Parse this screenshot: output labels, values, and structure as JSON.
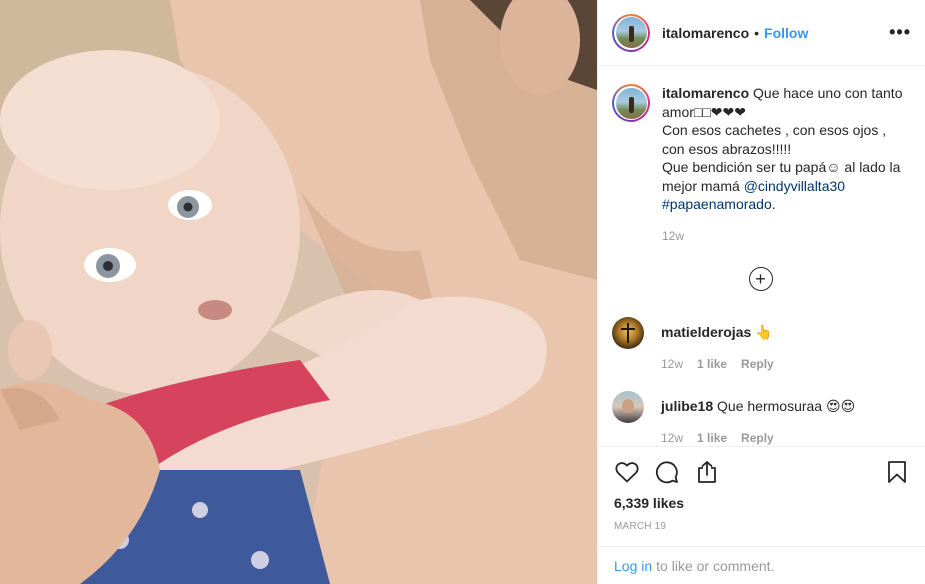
{
  "post": {
    "username": "italomarenco",
    "follow_label": "Follow",
    "separator": "•",
    "more_label": "•••",
    "caption": {
      "username": "italomarenco",
      "line1": "Que hace uno con tanto amor□□❤❤❤",
      "line2": "Con esos cachetes , con esos ojos , con esos abrazos!!!!!",
      "line3": "Que bendición ser tu papá☺ al lado la mejor mamá ",
      "mention": "@cindyvillalta30",
      "hashtag": "#papaenamorado",
      "hashtag_suffix": ".",
      "time": "12w"
    },
    "load_more_label": "+",
    "comments": [
      {
        "username": "matielderojas",
        "text": "👆",
        "time": "12w",
        "likes": "1 like",
        "reply": "Reply"
      },
      {
        "username": "julibe18",
        "text": "Que hermosuraa 😍😍",
        "time": "12w",
        "likes": "1 like",
        "reply": "Reply"
      }
    ],
    "likes": "6,339 likes",
    "date": "MARCH 19",
    "login_link": "Log in",
    "login_suffix": "to like or comment."
  },
  "icons": {
    "like": "heart-icon",
    "comment": "comment-icon",
    "share": "share-icon",
    "save": "bookmark-icon"
  }
}
